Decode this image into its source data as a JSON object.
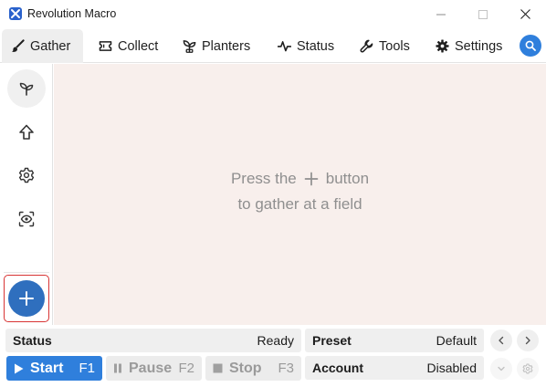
{
  "window": {
    "title": "Revolution Macro"
  },
  "tabs": [
    {
      "label": "Gather",
      "icon": "paint-brush-icon",
      "active": true
    },
    {
      "label": "Collect",
      "icon": "ticket-icon",
      "active": false
    },
    {
      "label": "Planters",
      "icon": "plant-icon",
      "active": false
    },
    {
      "label": "Status",
      "icon": "pulse-icon",
      "active": false
    },
    {
      "label": "Tools",
      "icon": "wrench-icon",
      "active": false
    },
    {
      "label": "Settings",
      "icon": "gear-icon",
      "active": false
    }
  ],
  "sidebar": {
    "items": [
      {
        "icon": "sprout-icon",
        "active": true
      },
      {
        "icon": "arrow-up-icon",
        "active": false
      },
      {
        "icon": "settings-icon",
        "active": false
      },
      {
        "icon": "eye-scan-icon",
        "active": false
      }
    ]
  },
  "main": {
    "line1_before": "Press the",
    "line1_after": "button",
    "line2": "to gather at a field"
  },
  "footer": {
    "status_label": "Status",
    "status_value": "Ready",
    "preset_label": "Preset",
    "preset_value": "Default",
    "account_label": "Account",
    "account_value": "Disabled",
    "start_label": "Start",
    "start_key": "F1",
    "pause_label": "Pause",
    "pause_key": "F2",
    "stop_label": "Stop",
    "stop_key": "F3"
  },
  "colors": {
    "accent": "#2f7fdc",
    "add_button": "#2f6fbe",
    "main_bg": "#f8efec",
    "highlight_border": "#d83434"
  }
}
